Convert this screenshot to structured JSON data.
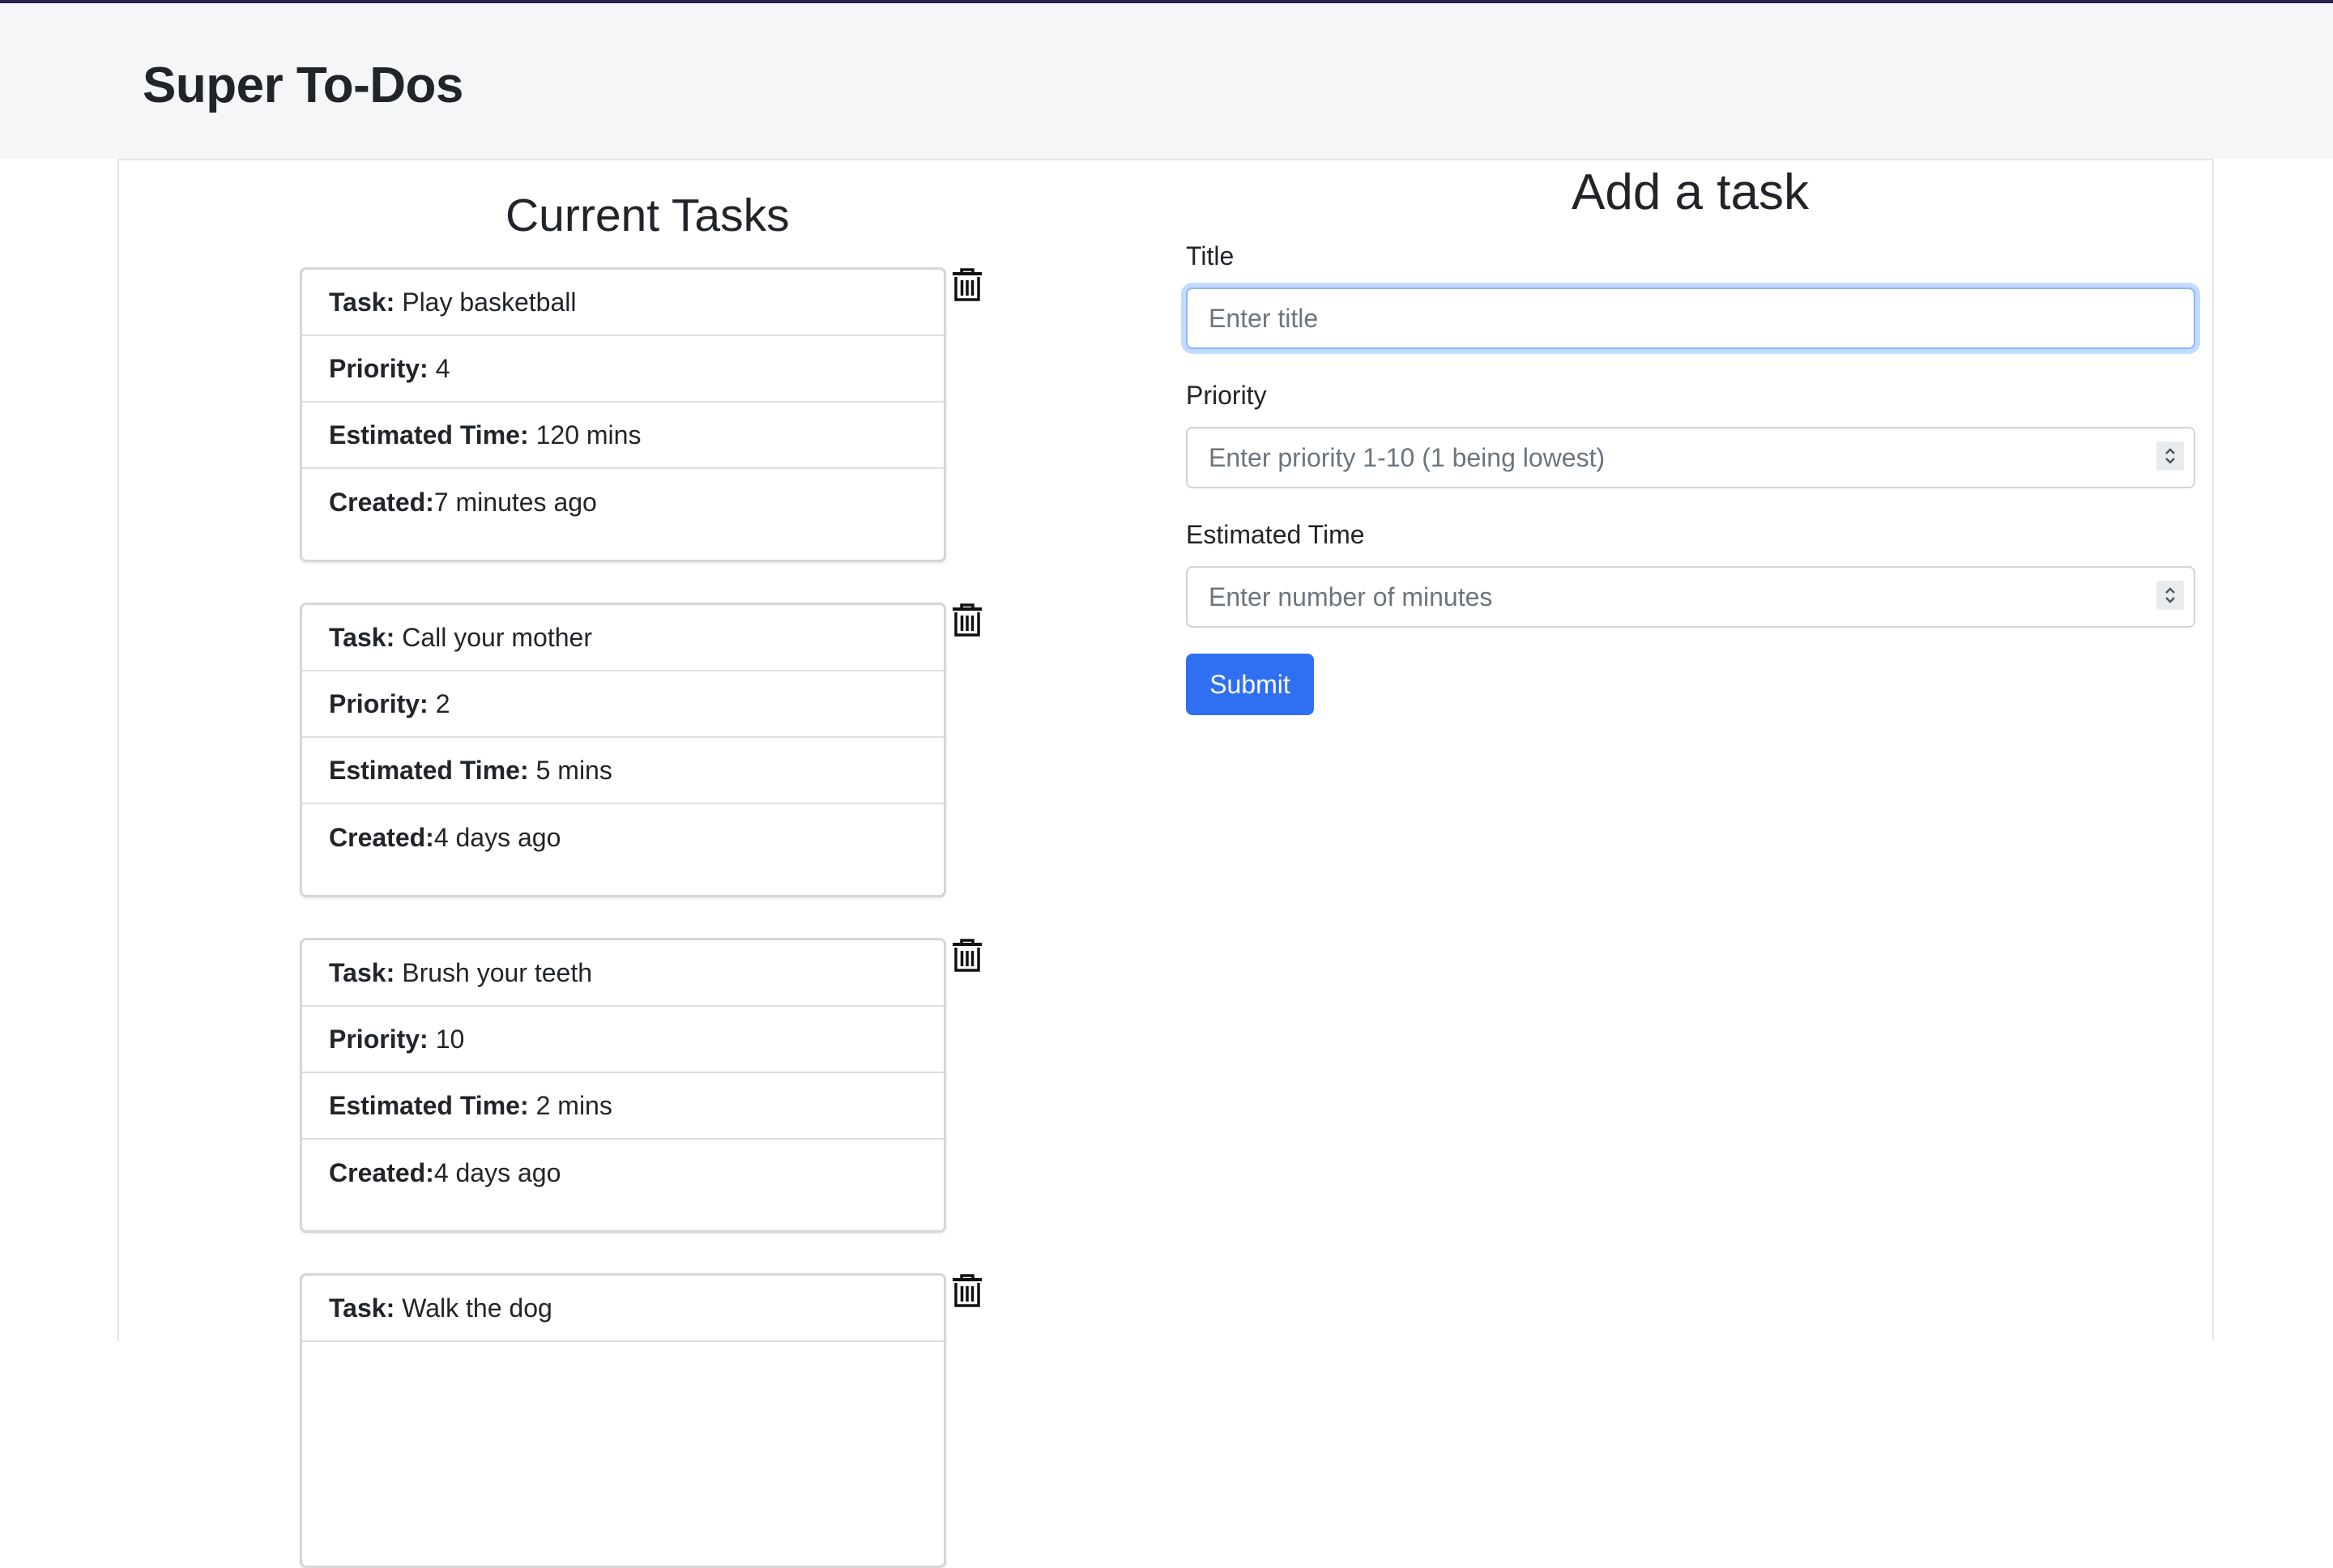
{
  "app": {
    "title": "Super To-Dos"
  },
  "tasks_section": {
    "heading": "Current Tasks",
    "labels": {
      "task": "Task:",
      "priority": "Priority:",
      "estimated_time": "Estimated Time:",
      "created": "Created:"
    },
    "tasks": [
      {
        "title": "Play basketball",
        "priority": "4",
        "estimated_time": "120 mins",
        "created": "7 minutes ago"
      },
      {
        "title": "Call your mother",
        "priority": "2",
        "estimated_time": "5 mins",
        "created": "4 days ago"
      },
      {
        "title": "Brush your teeth",
        "priority": "10",
        "estimated_time": "2 mins",
        "created": "4 days ago"
      },
      {
        "title": "Walk the dog"
      }
    ]
  },
  "form": {
    "heading": "Add a task",
    "title_label": "Title",
    "title_placeholder": "Enter title",
    "priority_label": "Priority",
    "priority_placeholder": "Enter priority 1-10 (1 being lowest)",
    "time_label": "Estimated Time",
    "time_placeholder": "Enter number of minutes",
    "submit_label": "Submit"
  },
  "colors": {
    "accent": "#2f6ff2",
    "navbar_bg": "#f5f6f8",
    "top_border": "#2a2550",
    "focus_ring": "#86b7fe"
  },
  "icons": [
    "trash-icon",
    "spinner-arrows-icon"
  ]
}
